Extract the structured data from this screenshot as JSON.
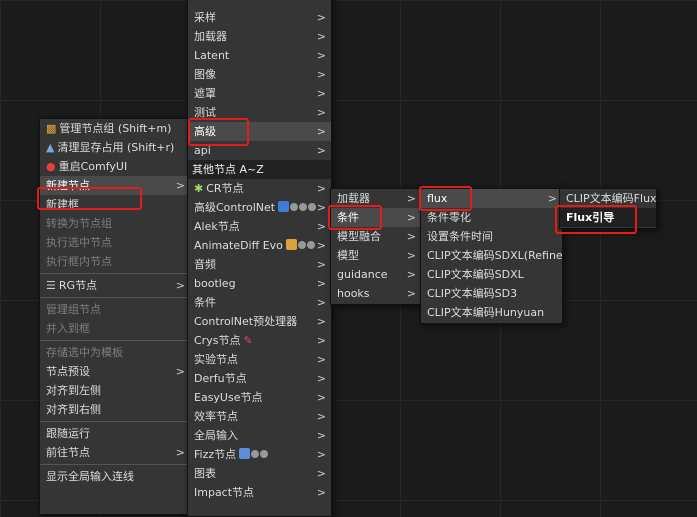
{
  "menu1": {
    "items": [
      {
        "label": "管理节点组 (Shift+m)",
        "icon": "sitemap-icon"
      },
      {
        "label": "清理显存占用 (Shift+r)",
        "icon": "rocket-icon"
      },
      {
        "label": "重启ComfyUI",
        "icon": "restart-icon"
      },
      {
        "label": "新建节点"
      },
      {
        "label": "新建框"
      },
      {
        "label": "转换为节点组"
      },
      {
        "label": "执行选中节点"
      },
      {
        "label": "执行框内节点"
      },
      {
        "label": "RG节点",
        "icon": "rg-icon"
      },
      {
        "label": "管理组节点"
      },
      {
        "label": "并入到框"
      },
      {
        "label": "存储选中为模板"
      },
      {
        "label": "节点预设"
      },
      {
        "label": "对齐到左侧"
      },
      {
        "label": "对齐到右侧"
      },
      {
        "label": "跟随运行"
      },
      {
        "label": "前往节点"
      },
      {
        "label": "显示全局输入连线"
      }
    ]
  },
  "menu2": {
    "items": [
      "采样",
      "加载器",
      "Latent",
      "图像",
      "遮罩",
      "测试",
      "高级",
      "api"
    ],
    "section_header": "其他节点 A~Z",
    "items2": [
      "CR节点",
      "高级ControlNet",
      "Alek节点",
      "AnimateDiff Evo",
      "音频",
      "bootleg",
      "条件",
      "ControlNet预处理器",
      "Crys节点",
      "实验节点",
      "Derfu节点",
      "EasyUse节点",
      "效率节点",
      "全局输入",
      "Fizz节点",
      "图表",
      "Impact节点"
    ]
  },
  "menu3": {
    "items": [
      "加载器",
      "条件",
      "模型融合",
      "模型",
      "guidance",
      "hooks"
    ]
  },
  "menu4": {
    "items": [
      "flux",
      "条件零化",
      "设置条件时间",
      "CLIP文本编码SDXL(Refiner)",
      "CLIP文本编码SDXL",
      "CLIP文本编码SD3",
      "CLIP文本编码Hunyuan"
    ]
  },
  "menu5": {
    "items": [
      "CLIP文本编码Flux",
      "Flux引导"
    ]
  },
  "colors": {
    "highlight_box": "#e51b1b",
    "menu_bg": "#353535"
  }
}
